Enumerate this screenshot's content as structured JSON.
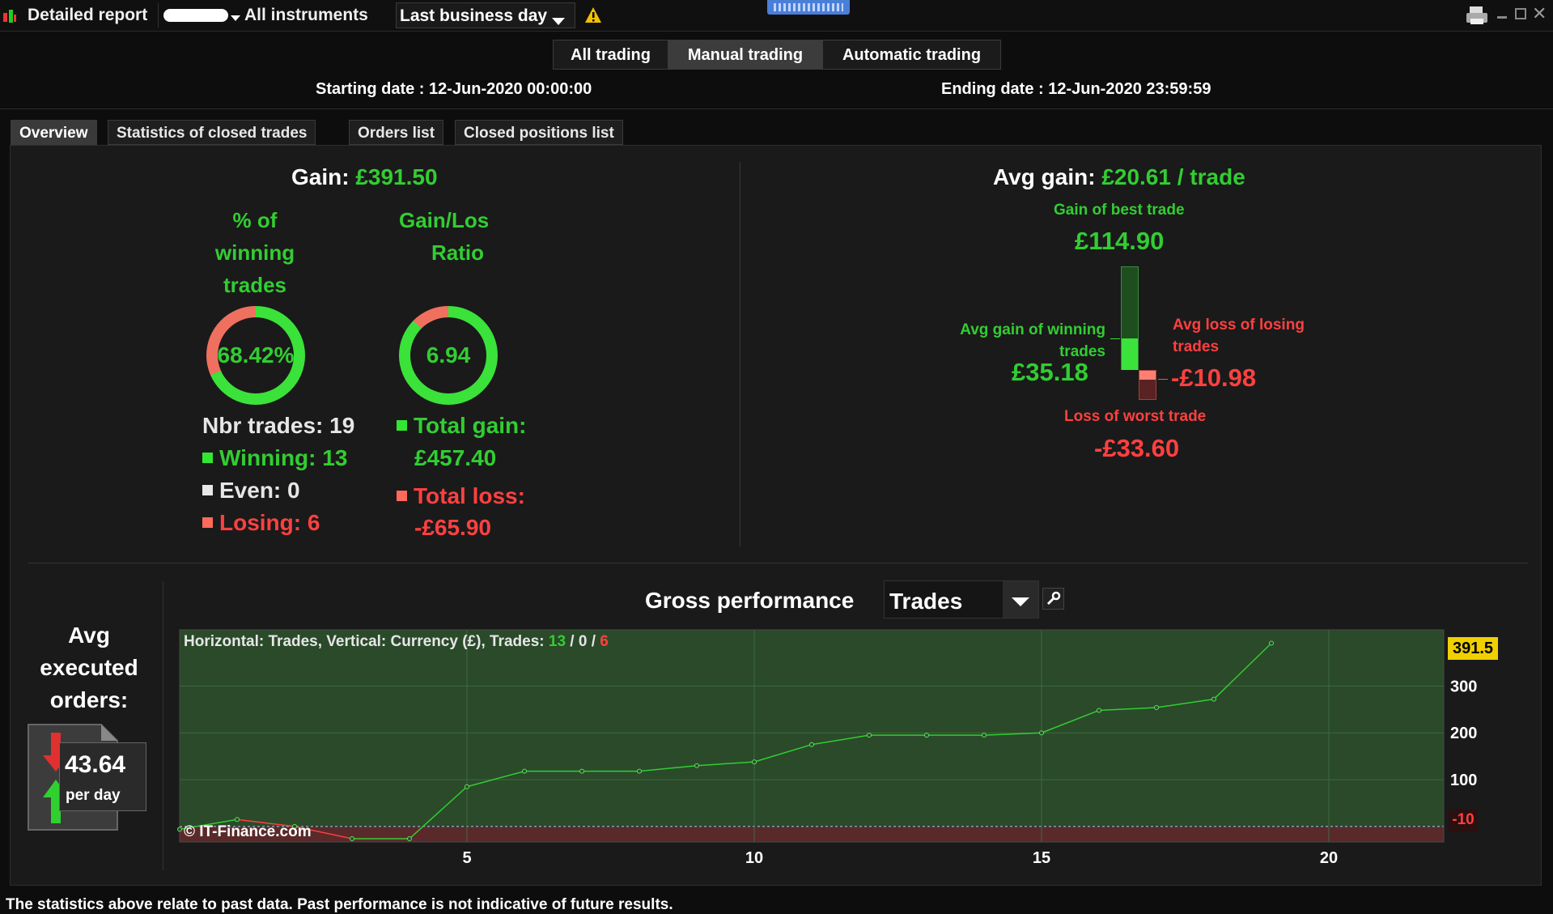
{
  "topbar": {
    "report_label": "Detailed report",
    "instruments_label": "All instruments",
    "period_value": "Last business day"
  },
  "modes": {
    "all": "All trading",
    "manual": "Manual trading",
    "auto": "Automatic trading",
    "active": "Manual trading"
  },
  "dates": {
    "start": "Starting date : 12-Jun-2020 00:00:00",
    "end": "Ending date : 12-Jun-2020 23:59:59"
  },
  "tabs": {
    "overview": "Overview",
    "stats": "Statistics of closed trades",
    "orders": "Orders list",
    "closed": "Closed positions list",
    "active": "Overview"
  },
  "overview": {
    "gain_label": "Gain:",
    "gain_value": "£391.50",
    "pct_label_1": "% of",
    "pct_label_2": "winning",
    "pct_label_3": "trades",
    "pct_value": "68.42%",
    "pct_fraction": 0.6842,
    "ratio_label_1": "Gain/Los",
    "ratio_label_2": "Ratio",
    "ratio_value": "6.94",
    "ratio_fraction": 0.874,
    "nbr_trades": "Nbr trades: 19",
    "winning": "Winning: 13",
    "even": "Even: 0",
    "losing": "Losing: 6",
    "total_gain_label": "Total gain:",
    "total_gain_value": "£457.40",
    "total_loss_label": "Total loss:",
    "total_loss_value": "-£65.90"
  },
  "avg": {
    "label": "Avg gain:",
    "value": "£20.61 / trade",
    "best_label": "Gain of best trade",
    "best_value": "£114.90",
    "avg_win_label_1": "Avg gain of winning",
    "avg_win_label_2": "trades",
    "avg_win_value": "£35.18",
    "avg_loss_label_1": "Avg loss of losing",
    "avg_loss_label_2": "trades",
    "avg_loss_value": "-£10.98",
    "worst_label": "Loss of worst trade",
    "worst_value": "-£33.60"
  },
  "orders": {
    "label_1": "Avg",
    "label_2": "executed",
    "label_3": "orders:",
    "value": "43.64",
    "unit": "per day"
  },
  "performance": {
    "title": "Gross performance",
    "select_value": "Trades",
    "legend_prefix": "Horizontal: Trades, Vertical: Currency (£), Trades: ",
    "legend_win": "13",
    "legend_sep1": " / ",
    "legend_even": "0",
    "legend_sep2": " / ",
    "legend_loss": "6",
    "watermark": "© IT-Finance.com",
    "last_value_label": "391.5",
    "min_value_label": "-10"
  },
  "chart_data": {
    "type": "line",
    "x": [
      0,
      1,
      2,
      3,
      4,
      5,
      6,
      7,
      8,
      9,
      10,
      11,
      12,
      13,
      14,
      15,
      16,
      17,
      18,
      19
    ],
    "y": [
      -6,
      15,
      0,
      -26,
      -26,
      85,
      118,
      118,
      118,
      130,
      138,
      175,
      195,
      195,
      195,
      200,
      248,
      254,
      272,
      391.5
    ],
    "xlabel": "Trades",
    "ylabel": "Currency (£)",
    "xticks": [
      5,
      10,
      15,
      20
    ],
    "yticks": [
      100,
      200,
      300
    ],
    "xlim": [
      0,
      22
    ],
    "ylim": [
      -33,
      420
    ],
    "colors": {
      "up": "#32cd32",
      "down": "#ff4040",
      "pos_area": "#2a4a2a",
      "neg_area": "#5a2a2a"
    }
  },
  "footer": {
    "disclaimer": "The statistics above relate to past data. Past performance is not indicative of future results."
  }
}
